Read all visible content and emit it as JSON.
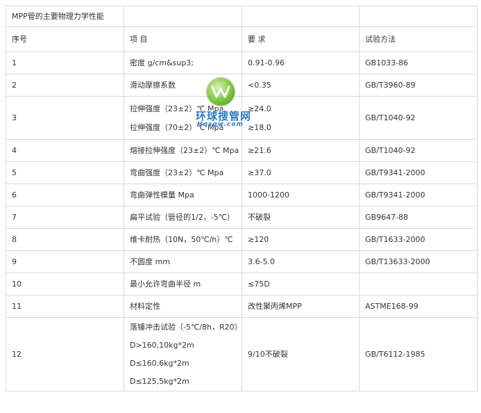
{
  "table": {
    "title": "MPP管的主要物理力学性能",
    "headers": [
      "序号",
      "项 目",
      "要 求",
      "试验方法"
    ],
    "rows": [
      {
        "no": "1",
        "items": [
          "密度 g/cm&sup3;"
        ],
        "req": [
          "0.91-0.96"
        ],
        "method": "GB1033-86"
      },
      {
        "no": "2",
        "items": [
          "滑动摩擦系数"
        ],
        "req": [
          "<0.35"
        ],
        "method": "GB/T3960-89"
      },
      {
        "no": "3",
        "items": [
          "拉伸强度（23±2）℃ Mpa",
          "拉伸强度（70±2）℃ Mpa"
        ],
        "req": [
          "≥24.0",
          "≥18.0"
        ],
        "method": "GB/T1040-92"
      },
      {
        "no": "4",
        "items": [
          "熔接拉伸强度（23±2）℃ Mpa"
        ],
        "req": [
          "≥21.6"
        ],
        "method": "GB/T1040-92"
      },
      {
        "no": "5",
        "items": [
          "弯曲强度（23±2）℃ Mpa"
        ],
        "req": [
          "≥37.0"
        ],
        "method": "GB/T9341-2000"
      },
      {
        "no": "6",
        "items": [
          "弯曲弹性模量 Mpa"
        ],
        "req": [
          "1000-1200"
        ],
        "method": "GB/T9341-2000"
      },
      {
        "no": "7",
        "items": [
          "扁平试验（管径的1/2，-5℃）"
        ],
        "req": [
          "不破裂"
        ],
        "method": "GB9647-88"
      },
      {
        "no": "8",
        "items": [
          "维卡耐热（10N，50℃/h）℃"
        ],
        "req": [
          "≥120"
        ],
        "method": "GB/T1633-2000"
      },
      {
        "no": "9",
        "items": [
          "不圆度 mm"
        ],
        "req": [
          "3.6-5.0"
        ],
        "method": "GB/T13633-2000"
      },
      {
        "no": "10",
        "items": [
          "最小允许弯曲半径 m"
        ],
        "req": [
          "≤75D"
        ],
        "method": ""
      },
      {
        "no": "11",
        "items": [
          "材料定性"
        ],
        "req": [
          "改性聚丙烯MPP"
        ],
        "method": "ASTME168-99"
      },
      {
        "no": "12",
        "items": [
          "落锤冲击试验（-5℃/8h，R20）",
          "D>160,10kg*2m",
          "D≤160,6kg*2m",
          "D≤125,5kg*2m"
        ],
        "req": [
          "9/10不破裂"
        ],
        "method": "GB/T6112-1985"
      }
    ]
  },
  "watermark": {
    "name": "环球搜管网",
    "domain": "Hqsgw.com",
    "colors": {
      "green": "#7cc53c",
      "blue": "#2a7cc7"
    }
  },
  "colors": {
    "border": "#d9d9d9",
    "text": "#333333"
  }
}
